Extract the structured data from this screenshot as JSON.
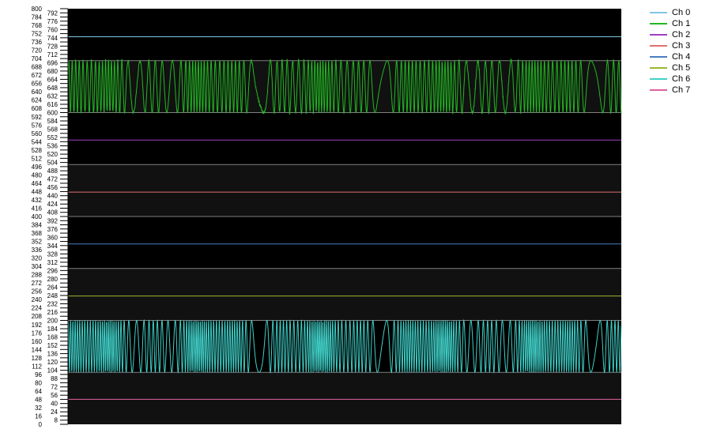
{
  "chart_data": {
    "type": "line",
    "ylim": [
      0,
      800
    ],
    "y_ticks": [
      0,
      8,
      16,
      24,
      32,
      40,
      48,
      56,
      64,
      72,
      80,
      88,
      96,
      104,
      112,
      120,
      128,
      136,
      144,
      152,
      160,
      168,
      176,
      184,
      192,
      200,
      208,
      216,
      224,
      232,
      240,
      248,
      256,
      264,
      272,
      280,
      288,
      296,
      304,
      312,
      320,
      328,
      336,
      344,
      352,
      360,
      368,
      376,
      384,
      392,
      400,
      408,
      416,
      424,
      432,
      440,
      448,
      456,
      464,
      472,
      480,
      488,
      496,
      504,
      512,
      520,
      528,
      536,
      544,
      552,
      560,
      568,
      576,
      584,
      592,
      600,
      608,
      616,
      624,
      632,
      640,
      648,
      656,
      664,
      672,
      680,
      688,
      696,
      704,
      712,
      720,
      728,
      736,
      744,
      752,
      760,
      768,
      776,
      784,
      792,
      800
    ],
    "band_boundaries": [
      0,
      100,
      200,
      300,
      400,
      500,
      600,
      700,
      800
    ],
    "background": "#000000",
    "band_alt_color": "#111111",
    "grid_color": "#808080",
    "legend_position": "right",
    "series": [
      {
        "name": "Ch 0",
        "color": "#7ec8e3",
        "kind": "flat",
        "level": 746
      },
      {
        "name": "Ch 1",
        "color": "#22b822",
        "kind": "fm",
        "mid": 650,
        "amp": 50,
        "cycles": 110,
        "noise": 8
      },
      {
        "name": "Ch 2",
        "color": "#a040c0",
        "kind": "flat",
        "level": 547
      },
      {
        "name": "Ch 3",
        "color": "#e07070",
        "kind": "flat",
        "level": 447
      },
      {
        "name": "Ch 4",
        "color": "#4a7ec0",
        "kind": "flat",
        "level": 347
      },
      {
        "name": "Ch 5",
        "color": "#9ab830",
        "kind": "flat",
        "level": 247
      },
      {
        "name": "Ch 6",
        "color": "#40d0c8",
        "kind": "fm",
        "mid": 150,
        "amp": 50,
        "cycles": 170,
        "noise": 0
      },
      {
        "name": "Ch 7",
        "color": "#e060a0",
        "kind": "flat",
        "level": 48
      }
    ]
  }
}
